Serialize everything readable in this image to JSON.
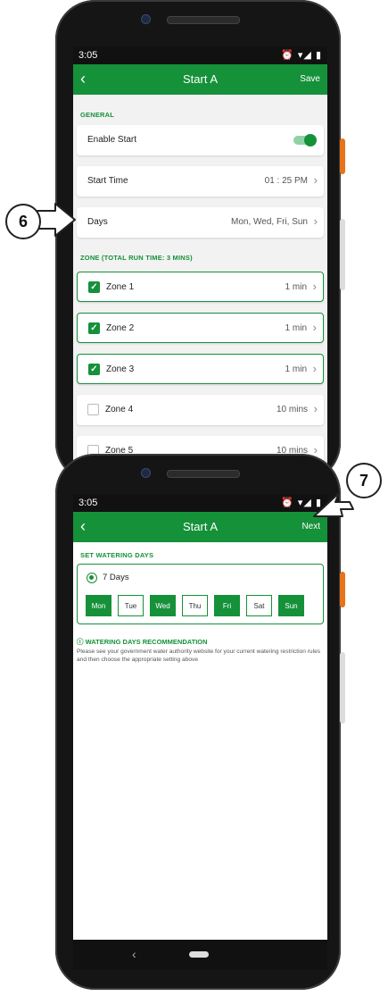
{
  "colors": {
    "brand_green": "#15913a",
    "callout_border": "#222222"
  },
  "screen1": {
    "status_time": "3:05",
    "status_icons": "⏰ ▾◢ ▮",
    "back_icon": "chevron-left-icon",
    "title": "Start A",
    "action": "Save",
    "general_header": "GENERAL",
    "enable_start_label": "Enable Start",
    "enable_start_on": true,
    "start_time_label": "Start Time",
    "start_time_value": "01 : 25 PM",
    "days_label": "Days",
    "days_value": "Mon, Wed, Fri, Sun",
    "zone_header": "ZONE (TOTAL RUN TIME: 3 MINS)",
    "zones": [
      {
        "name": "Zone 1",
        "value": "1 min",
        "checked": true
      },
      {
        "name": "Zone 2",
        "value": "1 min",
        "checked": true
      },
      {
        "name": "Zone 3",
        "value": "1 min",
        "checked": true
      },
      {
        "name": "Zone 4",
        "value": "10 mins",
        "checked": false
      },
      {
        "name": "Zone 5",
        "value": "10 mins",
        "checked": false
      }
    ]
  },
  "screen2": {
    "status_time": "3:05",
    "status_icons": "⏰ ▾◢ ▮",
    "title": "Start A",
    "action": "Next",
    "section_header": "SET WATERING DAYS",
    "option_label": "7 Days",
    "days": [
      {
        "label": "Mon",
        "on": true
      },
      {
        "label": "Tue",
        "on": false
      },
      {
        "label": "Wed",
        "on": true
      },
      {
        "label": "Thu",
        "on": false
      },
      {
        "label": "Fri",
        "on": true
      },
      {
        "label": "Sat",
        "on": false
      },
      {
        "label": "Sun",
        "on": true
      }
    ],
    "recommendation_title": "WATERING DAYS RECOMMENDATION",
    "recommendation_text": "Please see your government water authority website for your current watering restriction rules and then choose the appropriate setting above"
  },
  "callouts": {
    "six": "6",
    "seven": "7"
  }
}
